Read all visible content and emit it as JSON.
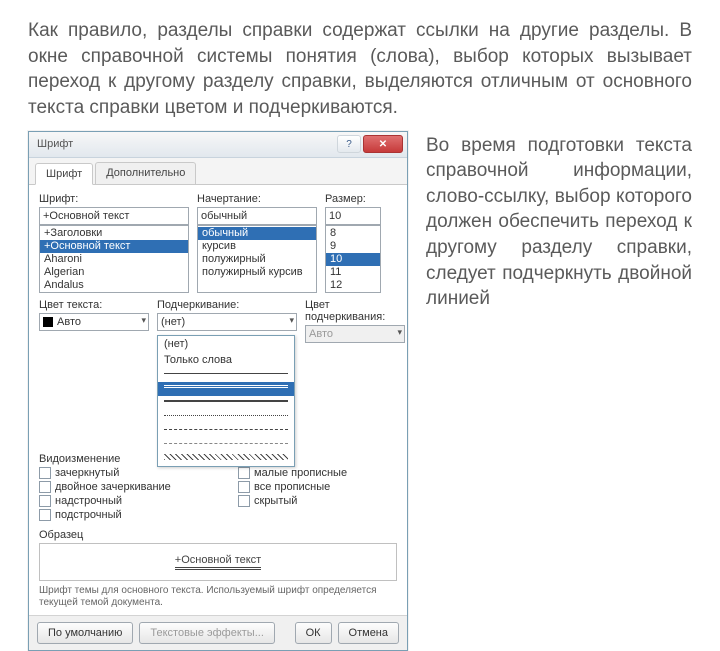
{
  "intro": "Как правило, разделы справки содержат ссылки на другие разделы. В окне справочной системы понятия (слова), выбор которых вызывает переход к другому разделу справки, выделяются отличным от основного текста справки цветом и подчеркиваются.",
  "side": "Во время подготовки текста справочной информации, слово-ссылку, выбор которого должен обеспечить переход к другому разделу справки, следует подчеркнуть двойной линией",
  "dialog": {
    "title": "Шрифт",
    "tabs": {
      "font": "Шрифт",
      "advanced": "Дополнительно"
    },
    "labels": {
      "font": "Шрифт:",
      "style": "Начертание:",
      "size": "Размер:",
      "color": "Цвет текста:",
      "underline": "Подчеркивание:",
      "ulcolor": "Цвет подчеркивания:",
      "effects": "Видоизменение",
      "sample": "Образец"
    },
    "font": {
      "value": "+Основной текст",
      "items": [
        "+Заголовки",
        "+Основной текст",
        "Aharoni",
        "Algerian",
        "Andalus"
      ],
      "selected": 1
    },
    "style": {
      "value": "обычный",
      "items": [
        "обычный",
        "курсив",
        "полужирный",
        "полужирный курсив"
      ],
      "selected": 0
    },
    "size": {
      "value": "10",
      "items": [
        "8",
        "9",
        "10",
        "11",
        "12"
      ],
      "selected": 2
    },
    "color_value": "Авто",
    "underline_value": "(нет)",
    "underline_options": {
      "none": "(нет)",
      "words": "Только слова"
    },
    "ulcolor_value": "Авто",
    "effects": {
      "strike": "зачеркнутый",
      "dstrike": "двойное зачеркивание",
      "superscript": "надстрочный",
      "subscript": "подстрочный",
      "smallcaps": "малые прописные",
      "allcaps": "все прописные",
      "hidden": "скрытый"
    },
    "sample_text": "+Основной текст",
    "sample_note": "Шрифт темы для основного текста. Используемый шрифт определяется текущей темой документа.",
    "buttons": {
      "default": "По умолчанию",
      "texteffects": "Текстовые эффекты...",
      "ok": "ОК",
      "cancel": "Отмена"
    }
  }
}
